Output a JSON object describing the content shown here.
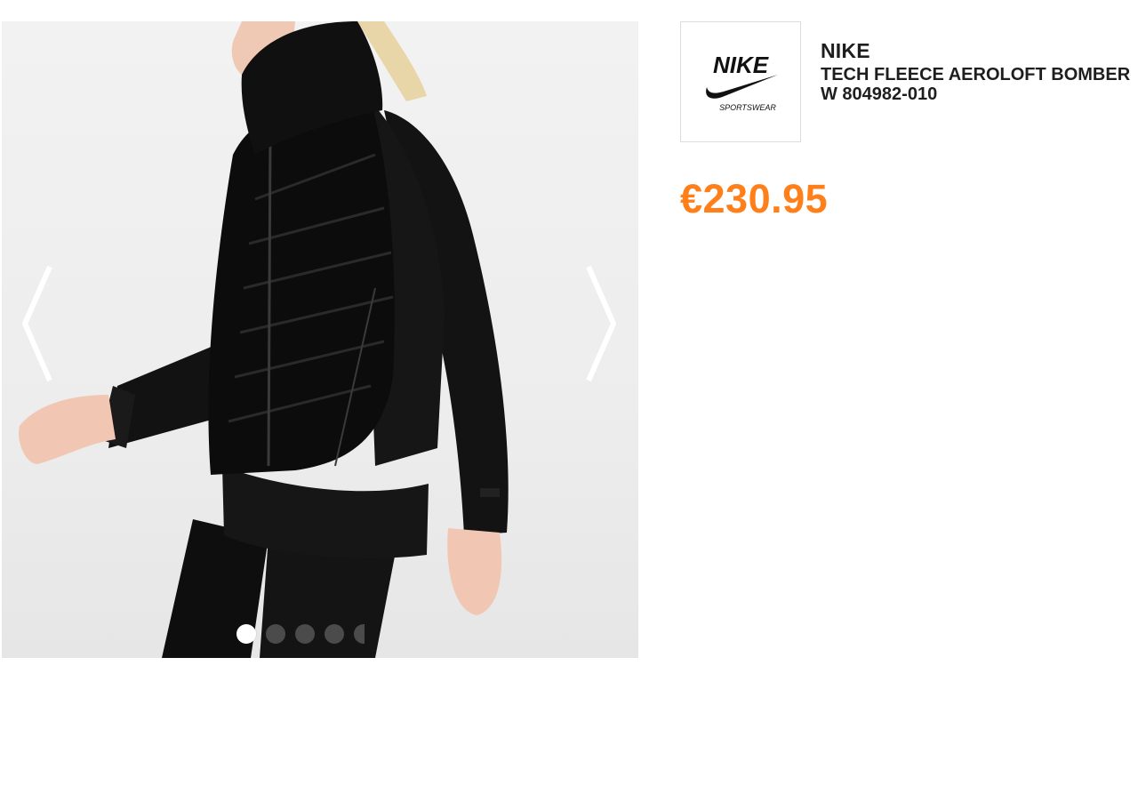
{
  "gallery": {
    "image_alt": "Woman wearing black Nike Tech Fleece Aeroloft Bomber jacket",
    "prev_icon": "chevron-left-icon",
    "next_icon": "chevron-right-icon",
    "dots": {
      "count_visible": 5,
      "active_index": 0
    }
  },
  "brand_logo": {
    "wordmark": "NIKE",
    "subtitle": "SPORTSWEAR",
    "icon": "nike-swoosh-icon"
  },
  "product": {
    "brand": "NIKE",
    "name": "TECH FLEECE AEROLOFT BOMBER W 804982-010",
    "price": "€230.95"
  },
  "colors": {
    "price": "#ff7f1a",
    "text": "#1e1e1e",
    "image_bg": "#efefef"
  }
}
